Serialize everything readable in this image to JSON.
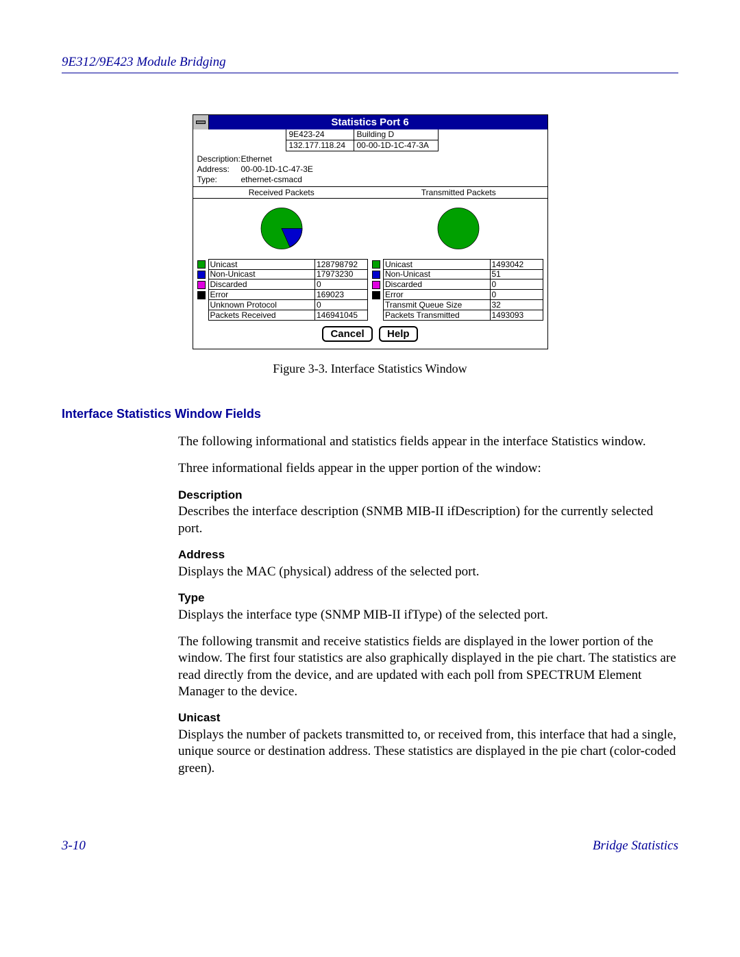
{
  "header": "9E312/9E423 Module Bridging",
  "dialog": {
    "title": "Statistics Port 6",
    "info": {
      "deviceName": "9E423-24",
      "building": "Building D",
      "ip": "132.177.118.24",
      "mac": "00-00-1D-1C-47-3A"
    },
    "desc": {
      "descriptionLabel": "Description:",
      "descriptionValue": "Ethernet",
      "addressLabel": "Address:",
      "addressValue": "00-00-1D-1C-47-3E",
      "typeLabel": "Type:",
      "typeValue": "ethernet-csmacd"
    },
    "receivedHeader": "Received Packets",
    "transmittedHeader": "Transmitted Packets",
    "receivedStats": [
      {
        "label": "Unicast",
        "value": "128798792",
        "swatch": "green"
      },
      {
        "label": "Non-Unicast",
        "value": "17973230",
        "swatch": "blue"
      },
      {
        "label": "Discarded",
        "value": "0",
        "swatch": "magenta"
      },
      {
        "label": "Error",
        "value": "169023",
        "swatch": "black"
      },
      {
        "label": "Unknown Protocol",
        "value": "0",
        "swatch": null
      },
      {
        "label": "Packets Received",
        "value": "146941045",
        "swatch": null
      }
    ],
    "transmittedStats": [
      {
        "label": "Unicast",
        "value": "1493042",
        "swatch": "green"
      },
      {
        "label": "Non-Unicast",
        "value": "51",
        "swatch": "blue"
      },
      {
        "label": "Discarded",
        "value": "0",
        "swatch": "magenta"
      },
      {
        "label": "Error",
        "value": "0",
        "swatch": "black"
      },
      {
        "label": "Transmit Queue Size",
        "value": "32",
        "swatch": null
      },
      {
        "label": "Packets Transmitted",
        "value": "1493093",
        "swatch": null
      }
    ],
    "buttons": {
      "cancel": "Cancel",
      "help": "Help"
    }
  },
  "figureCaption": "Figure 3-3.  Interface Statistics Window",
  "sectionHeading": "Interface Statistics Window Fields",
  "body": {
    "intro1": "The following informational and statistics fields appear in the interface Statistics window.",
    "intro2": "Three informational fields appear in the upper portion of the window:",
    "descTitle": "Description",
    "descText": "Describes the interface description (SNMB MIB-II ifDescription) for the currently selected port.",
    "addrTitle": "Address",
    "addrText": "Displays the MAC (physical) address of the selected port.",
    "typeTitle": "Type",
    "typeText": "Displays the interface type (SNMP MIB-II ifType) of the selected port.",
    "statsIntro": "The following transmit and receive statistics fields are displayed in the lower portion of the window. The first four statistics are also graphically displayed in the pie chart. The statistics are read directly from the device, and are updated with each poll from SPECTRUM Element Manager to the device.",
    "unicastTitle": "Unicast",
    "unicastText": "Displays the number of packets transmitted to, or received from, this interface that had a single, unique source or destination address. These statistics are displayed in the pie chart (color-coded green)."
  },
  "footer": {
    "pageNum": "3-10",
    "section": "Bridge Statistics"
  },
  "chart_data": [
    {
      "type": "pie",
      "title": "Received Packets",
      "series": [
        {
          "name": "Unicast",
          "value": 128798792,
          "color": "#00a000"
        },
        {
          "name": "Non-Unicast",
          "value": 17973230,
          "color": "#0000cc"
        },
        {
          "name": "Discarded",
          "value": 0,
          "color": "#e000e0"
        },
        {
          "name": "Error",
          "value": 169023,
          "color": "#000000"
        }
      ]
    },
    {
      "type": "pie",
      "title": "Transmitted Packets",
      "series": [
        {
          "name": "Unicast",
          "value": 1493042,
          "color": "#00a000"
        },
        {
          "name": "Non-Unicast",
          "value": 51,
          "color": "#0000cc"
        },
        {
          "name": "Discarded",
          "value": 0,
          "color": "#e000e0"
        },
        {
          "name": "Error",
          "value": 0,
          "color": "#000000"
        }
      ]
    }
  ]
}
